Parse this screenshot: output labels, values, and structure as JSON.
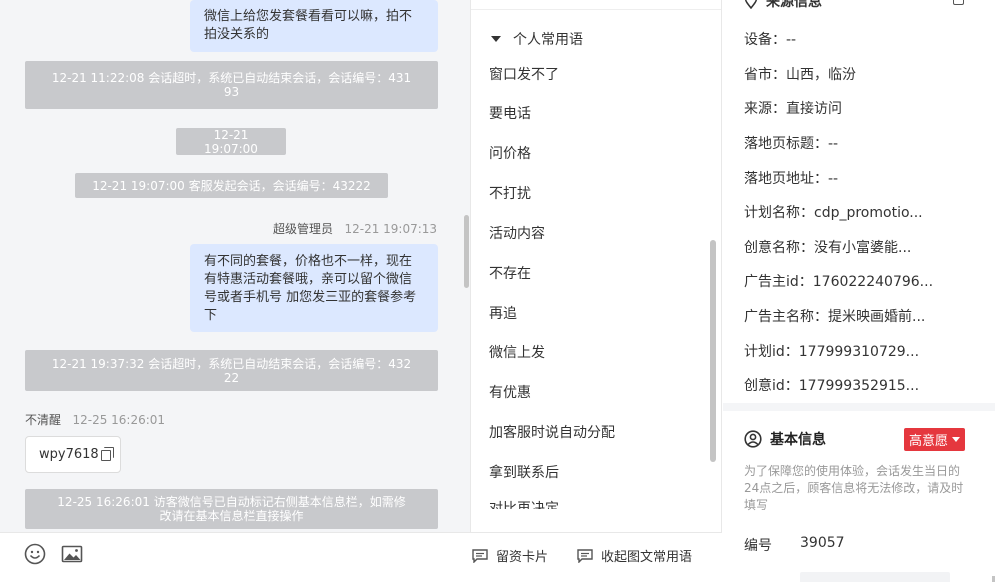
{
  "chat": {
    "msg1": {
      "line1": "微信上给您发套餐看看可以嘛，拍不",
      "line2": "拍没关系的"
    },
    "sys1": {
      "line1": "12-21 11:22:08 会话超时，系统已自动结束会话，会话编号：431",
      "line2": "93"
    },
    "time1": "12-21 19:07:00",
    "sys2": "12-21 19:07:00 客服发起会话，会话编号：43222",
    "msg2_meta": {
      "sender": "超级管理员",
      "time": "12-21 19:07:13"
    },
    "msg2": {
      "line1": "有不同的套餐，价格也不一样，现在",
      "line2": "有特惠活动套餐哦，亲可以留个微信",
      "line3": "号或者手机号 加您发三亚的套餐参考",
      "line4": "下"
    },
    "sys3": {
      "line1": "12-21 19:37:32 会话超时，系统已自动结束会话，会话编号：432",
      "line2": "22"
    },
    "msg3_meta": {
      "sender": "不清醒",
      "time": "12-25 16:26:01"
    },
    "copy_text": "wpy7618",
    "sys4": {
      "line1": "12-25 16:26:01 访客微信号已自动标记右侧基本信息栏，如需修",
      "line2": "改请在基本信息栏直接操作"
    }
  },
  "toolbar": {
    "emoji_icon": "emoji-icon",
    "image_icon": "image-icon",
    "card_label": "留资卡片",
    "collapse_label": "收起图文常用语"
  },
  "phrases": {
    "group_title": "个人常用语",
    "items": [
      "窗口发不了",
      "要电话",
      "问价格",
      "不打扰",
      "活动内容",
      "不存在",
      "再追",
      "微信上发",
      "有优惠",
      "加客服时说自动分配",
      "拿到联系后",
      "对比再决定"
    ]
  },
  "info": {
    "source_title": "来源信息",
    "rows": [
      "设备：--",
      "省市：山西，临汾",
      "来源：直接访问",
      "落地页标题：--",
      "落地页地址：--",
      "计划名称：cdp_promotio...",
      "创意名称：没有小富婆能...",
      "广告主id：176022240796...",
      "广告主名称：提米映画婚前...",
      "计划id：177999310729...",
      "创意id：177999352915..."
    ],
    "basic_title": "基本信息",
    "intent_badge": "高意愿",
    "notice": "为了保障您的使用体验，会话发生当日的24点之后，顾客信息将无法修改，请及时填写",
    "number_label": "编号",
    "number_value": "39057"
  },
  "colors": {
    "bubble": "#dce8ff",
    "system": "#c8c9cc",
    "badge": "#e5373e",
    "panel_bg": "#f4f5f7"
  }
}
